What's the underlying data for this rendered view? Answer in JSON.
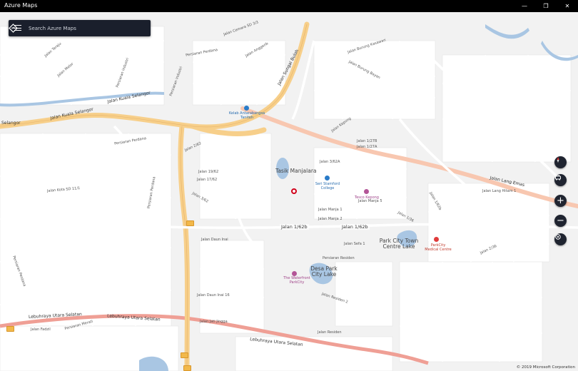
{
  "window": {
    "title": "Azure Maps",
    "minimize_glyph": "—",
    "restore_glyph": "❐",
    "close_glyph": "✕"
  },
  "search": {
    "placeholder": "Search Azure Maps",
    "value": ""
  },
  "map": {
    "colors": {
      "background": "#f2f2f2",
      "building": "#ffffff",
      "major_highway": "#f7cf8a",
      "secondary_road": "#f8c7b0",
      "highway_red": "#e9968b",
      "water": "#a9c6e3",
      "toolbar": "#1f2430"
    },
    "area_labels": {
      "tasik_manjalara": "Tasik Manjalara",
      "desa_park": "Desa Park City Lake",
      "park_city_town": "Park City Town Centre Lake"
    },
    "poi_labels": {
      "kelab": "Kelab Antarabangsa Taniteh",
      "segi": "Seri Stamford College",
      "tesco": "Tesco Kepong",
      "waterfront": "The Waterfront ParkCity",
      "parkcity_medical": "ParkCity Medical Centre"
    },
    "road_labels": {
      "jalan_1_62b": "Jalan 1/62b",
      "jalan_1_62b_east": "Jalan 1/62b",
      "lebuhraya_1": "Lebuhraya Utara Selatan",
      "lebuhraya_2": "Lebuhraya Utara Selatan",
      "lebuhraya_3": "Lebuhraya Utara Selatan",
      "jalan_kuala_selangor": "Jalan Kuala Selangor",
      "jalan_kuala_selangor_2": "Jalan Kuala Selangor",
      "selangor": "Selangor",
      "jalan_sungai_buloh": "Jalan Sungai Buloh",
      "jalan_lang_emas": "Jalan Lang Emas",
      "persiaran_perdana": "Persiaran Perdana",
      "persiaran_perdana_2": "Persiaran Perdana",
      "persiaran_perdana_3": "Persiaran Perdana",
      "persiaran_perdana_4": "Persiaran Perdana",
      "persiaran_industri": "Persiaran Industri",
      "persiaran_industri_2": "Persiaran Industri",
      "persiaran_residen": "Persiaran Residen",
      "jalan_residen": "Jalan Residen",
      "jalan_residen_2": "Jalan Residen 2",
      "jalan_manja_1": "Jalan Manja 1",
      "jalan_manja_2": "Jalan Manja 2",
      "jalan_manja_5": "Jalan Manja 5",
      "jalan_3_62a": "Jalan 3/62A",
      "jalan_2_62": "Jalan 2/62",
      "jalan_19_62": "Jalan 19/62",
      "jalan_17_62": "Jalan 17/62",
      "jalan_daun_inai": "Jalan Daun Inai",
      "jalan_daun_inai_16": "Jalan Daun Inai 16",
      "jalan_jati_jingga": "Jalan Jati Jingga",
      "jalan_fadzil": "Jalan Fadzil",
      "persiaran_merati": "Persiaran Merati",
      "jalan_lang_hitam": "Jalan Lang Hitam 1",
      "jalan_sefa": "Jalan Sefa 1",
      "jalan_1_27b": "Jalan 1/27B",
      "jalan_1_27a": "Jalan 1/27A",
      "jalan_bunga_kasawari": "Jalan Burung Kasawari",
      "jalan_bunga_bayan": "Jalan Burung Bayan",
      "jalan_1_36": "Jalan 1/36",
      "jalan_2_36": "Jalan 2/36",
      "jalan_1_62b_small": "Jalan 1/62b",
      "jalan_3_62": "Jalan 3/62",
      "jalan_kuala_selangor_3": "Jalan Kepong",
      "persiaran_anggerik": "Jalan Anggerik",
      "jalan_cemara": "Jalan Cemara SD 3/3",
      "jalan_melor": "Jalan Melor",
      "jalan_teraju": "Jalan Teraju",
      "jalan_kota": "Jalan Kota SD 11/1"
    },
    "copyright": "© 2019 Microsoft Corporation"
  },
  "controls": {
    "compass_icon": "compass-icon",
    "traffic_icon": "traffic-icon",
    "zoom_in_glyph": "+",
    "zoom_out_glyph": "−",
    "locate_icon": "locate-icon"
  }
}
